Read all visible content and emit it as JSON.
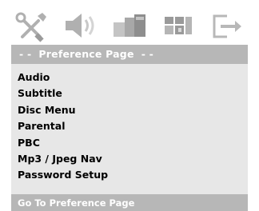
{
  "header": {
    "title": "- -  Preference Page  - -"
  },
  "tabs": [
    {
      "icon": "tools-icon",
      "selected": true
    },
    {
      "icon": "speaker-icon",
      "selected": false
    },
    {
      "icon": "video-icon",
      "selected": false
    },
    {
      "icon": "dolby-icon",
      "selected": false
    },
    {
      "icon": "exit-icon",
      "selected": false
    }
  ],
  "menu": {
    "items": [
      {
        "label": "Audio"
      },
      {
        "label": "Subtitle"
      },
      {
        "label": "Disc Menu"
      },
      {
        "label": "Parental"
      },
      {
        "label": "PBC"
      },
      {
        "label": "Mp3 / Jpeg Nav"
      },
      {
        "label": "Password Setup"
      }
    ]
  },
  "status": {
    "text": "Go To Preference Page"
  },
  "colors": {
    "bar": "#b7b7b7",
    "panel": "#e7e7e7",
    "icon": "#b0b0b0",
    "icon_dark": "#8a8a8a"
  }
}
